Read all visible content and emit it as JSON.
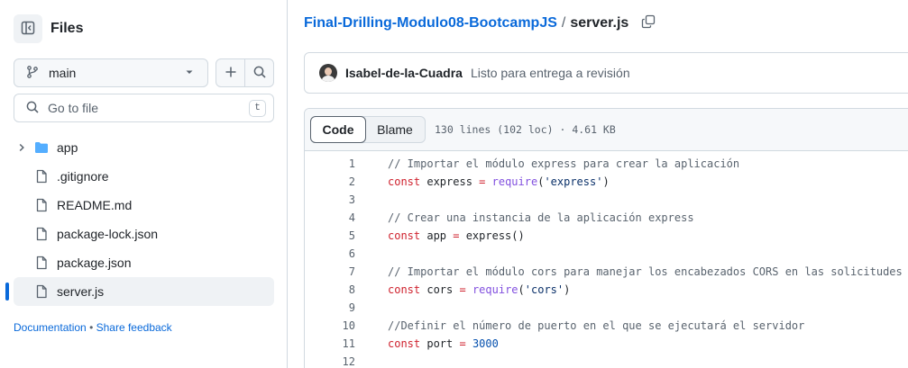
{
  "sidebar": {
    "title": "Files",
    "branch": "main",
    "search_placeholder": "Go to file",
    "search_shortcut": "t",
    "tree": [
      {
        "name": "app",
        "type": "folder",
        "expanded": false,
        "active": false
      },
      {
        "name": ".gitignore",
        "type": "file",
        "active": false
      },
      {
        "name": "README.md",
        "type": "file",
        "active": false
      },
      {
        "name": "package-lock.json",
        "type": "file",
        "active": false
      },
      {
        "name": "package.json",
        "type": "file",
        "active": false
      },
      {
        "name": "server.js",
        "type": "file",
        "active": true
      }
    ],
    "footer": {
      "documentation": "Documentation",
      "separator": "•",
      "feedback": "Share feedback"
    }
  },
  "breadcrumb": {
    "repo": "Final-Drilling-Modulo08-BootcampJS",
    "separator": "/",
    "file": "server.js"
  },
  "commit": {
    "author": "Isabel-de-la-Cuadra",
    "message": "Listo para entrega a revisión"
  },
  "code_view": {
    "tabs": {
      "code": "Code",
      "blame": "Blame"
    },
    "meta": "130 lines (102 loc) · 4.61 KB",
    "lines": [
      {
        "n": "1",
        "tokens": [
          {
            "t": "// Importar el módulo express para crear la aplicación",
            "c": "com"
          }
        ]
      },
      {
        "n": "2",
        "tokens": [
          {
            "t": "const",
            "c": "kw"
          },
          {
            "t": " express ",
            "c": ""
          },
          {
            "t": "=",
            "c": "kw"
          },
          {
            "t": " ",
            "c": ""
          },
          {
            "t": "require",
            "c": "fn"
          },
          {
            "t": "(",
            "c": ""
          },
          {
            "t": "'express'",
            "c": "str"
          },
          {
            "t": ")",
            "c": ""
          }
        ]
      },
      {
        "n": "3",
        "tokens": []
      },
      {
        "n": "4",
        "tokens": [
          {
            "t": "// Crear una instancia de la aplicación express",
            "c": "com"
          }
        ]
      },
      {
        "n": "5",
        "tokens": [
          {
            "t": "const",
            "c": "kw"
          },
          {
            "t": " app ",
            "c": ""
          },
          {
            "t": "=",
            "c": "kw"
          },
          {
            "t": " express()",
            "c": ""
          }
        ]
      },
      {
        "n": "6",
        "tokens": []
      },
      {
        "n": "7",
        "tokens": [
          {
            "t": "// Importar el módulo cors para manejar los encabezados CORS en las solicitudes",
            "c": "com"
          }
        ]
      },
      {
        "n": "8",
        "tokens": [
          {
            "t": "const",
            "c": "kw"
          },
          {
            "t": " cors ",
            "c": ""
          },
          {
            "t": "=",
            "c": "kw"
          },
          {
            "t": " ",
            "c": ""
          },
          {
            "t": "require",
            "c": "fn"
          },
          {
            "t": "(",
            "c": ""
          },
          {
            "t": "'cors'",
            "c": "str"
          },
          {
            "t": ")",
            "c": ""
          }
        ]
      },
      {
        "n": "9",
        "tokens": []
      },
      {
        "n": "10",
        "tokens": [
          {
            "t": "//Definir el número de puerto en el que se ejecutará el servidor",
            "c": "com"
          }
        ]
      },
      {
        "n": "11",
        "tokens": [
          {
            "t": "const",
            "c": "kw"
          },
          {
            "t": " port ",
            "c": ""
          },
          {
            "t": "=",
            "c": "kw"
          },
          {
            "t": " ",
            "c": ""
          },
          {
            "t": "3000",
            "c": "num"
          }
        ]
      },
      {
        "n": "12",
        "tokens": []
      }
    ]
  },
  "colors": {
    "accent": "#0969da",
    "folder": "#54aeff",
    "keyword": "#cf222e",
    "function": "#8250df",
    "string": "#0a3069",
    "comment": "#59636e",
    "number": "#0550ae"
  }
}
